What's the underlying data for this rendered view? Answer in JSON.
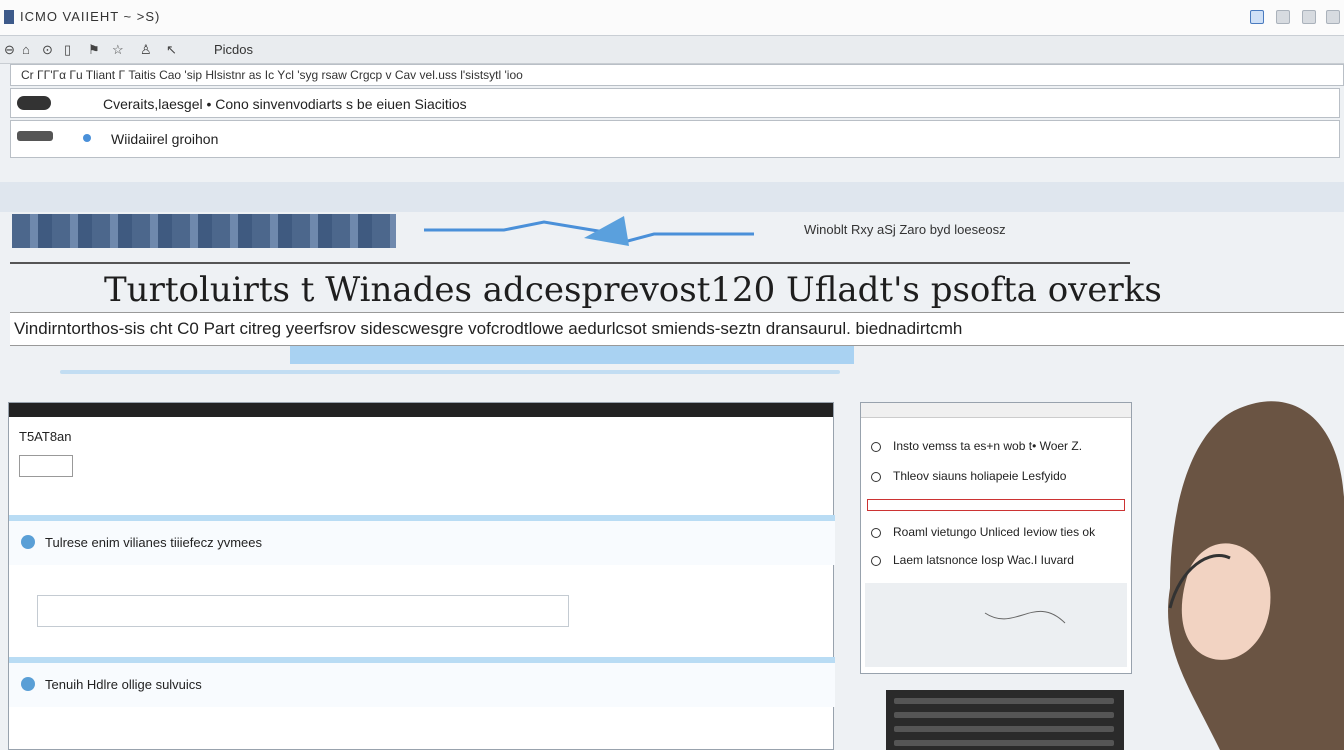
{
  "window": {
    "title": "ICMO VAIIEHT ~ >S)"
  },
  "toolbar": {
    "label": "Picdos",
    "icons": [
      "back-icon",
      "home-icon",
      "pin-icon",
      "folder-icon",
      "flag-icon",
      "star-icon",
      "person-icon",
      "cursor-icon"
    ]
  },
  "menubar": {
    "text": "Cr ΓΓ'Γα Γu Tliant  Γ Taitis Cao 'sip Hlsistnr as  Ic Ycl 'syg rsaw Crgcp v  Cav vel.uss  l'sistsytl 'ioo"
  },
  "row1": {
    "text": "Cveraits,laesgel • Cono sinvenvodiarts s be eiuen Siacitios"
  },
  "row2": {
    "text": "Wiidaiirel groihon"
  },
  "header_strip": {
    "text": "Winoblt Rxy aSj Zaro byd loeseosz"
  },
  "headline": "Turtoluirts t Winades adcesprevost120 Ufladt's psofta overks",
  "description": "Vindirntorthos-sis cht  C0 Part citreg yeerfsrov sidescwesgre vofcrodtlowe aedurlcsot smiends-seztn dransaurul. biednadirtcmh",
  "panel": {
    "header": "T5AT8an",
    "sections": [
      {
        "text": "Tulrese enim vilianes tiiiefecz yvmees"
      },
      {
        "text": "Tenuih Hdlre ollige sulvuics"
      }
    ]
  },
  "rpanel": {
    "items": [
      "Insto vemss ta es+n wob t• Woer Z.",
      "Thleov siauns holiapeie Lesfyido",
      "Roaml vietungo Unliced Ieviow ties ok",
      "Laem latsnonce Iosp Wac.I Iuvard"
    ]
  }
}
